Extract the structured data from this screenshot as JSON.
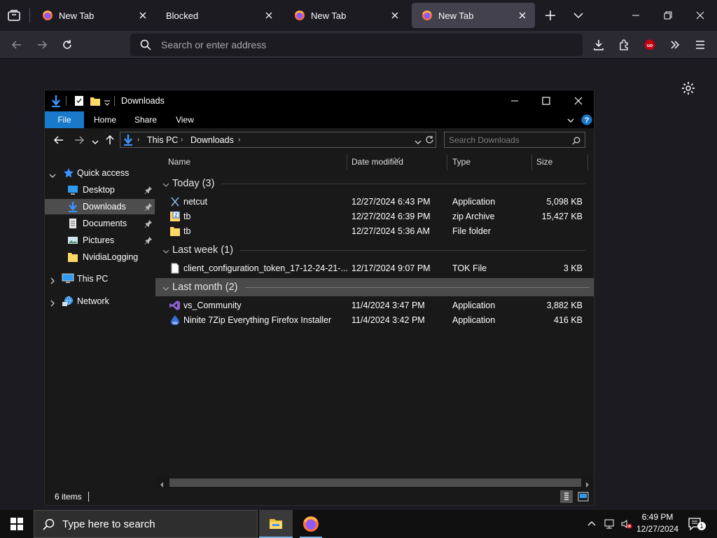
{
  "browser": {
    "tabs": [
      {
        "label": "New Tab",
        "active": false,
        "favicon": "firefox-icon"
      },
      {
        "label": "Blocked",
        "active": false,
        "favicon": ""
      },
      {
        "label": "New Tab",
        "active": false,
        "favicon": "firefox-icon"
      },
      {
        "label": "New Tab",
        "active": true,
        "favicon": "firefox-icon"
      }
    ],
    "urlbar": {
      "placeholder": "Search or enter address"
    },
    "toolbar_icons": [
      "download-icon",
      "extensions-icon",
      "ublock-icon",
      "overflow-icon",
      "menu-icon"
    ],
    "newtab_settings_icon": "gear-icon"
  },
  "explorer": {
    "title": "Downloads",
    "ribbon": {
      "file": "File",
      "home": "Home",
      "share": "Share",
      "view": "View"
    },
    "breadcrumb": {
      "root": "This PC",
      "current": "Downloads"
    },
    "search_placeholder": "Search Downloads",
    "nav": {
      "quick_access": "Quick access",
      "items": [
        {
          "label": "Desktop",
          "icon": "desktop-icon",
          "pinned": true
        },
        {
          "label": "Downloads",
          "icon": "download-arrow-icon",
          "pinned": true,
          "selected": true
        },
        {
          "label": "Documents",
          "icon": "documents-icon",
          "pinned": true
        },
        {
          "label": "Pictures",
          "icon": "pictures-icon",
          "pinned": true
        },
        {
          "label": "NvidiaLogging",
          "icon": "folder-icon",
          "pinned": false
        }
      ],
      "this_pc": "This PC",
      "network": "Network"
    },
    "columns": {
      "name": "Name",
      "date": "Date modified",
      "type": "Type",
      "size": "Size"
    },
    "groups": [
      {
        "label": "Today (3)",
        "files": [
          {
            "name": "netcut",
            "date": "12/27/2024 6:43 PM",
            "type": "Application",
            "size": "5,098 KB",
            "icon": "netcut-icon"
          },
          {
            "name": "tb",
            "date": "12/27/2024 6:39 PM",
            "type": "zip Archive",
            "size": "15,427 KB",
            "icon": "zip-icon"
          },
          {
            "name": "tb",
            "date": "12/27/2024 5:36 AM",
            "type": "File folder",
            "size": "",
            "icon": "folder-icon"
          }
        ]
      },
      {
        "label": "Last week (1)",
        "files": [
          {
            "name": "client_configuration_token_17-12-24-21-...",
            "date": "12/17/2024 9:07 PM",
            "type": "TOK File",
            "size": "3 KB",
            "icon": "file-icon"
          }
        ]
      },
      {
        "label": "Last month (2)",
        "files": [
          {
            "name": "vs_Community",
            "date": "11/4/2024 3:47 PM",
            "type": "Application",
            "size": "3,882 KB",
            "icon": "visual-studio-icon"
          },
          {
            "name": "Ninite 7Zip Everything Firefox Installer",
            "date": "11/4/2024 3:42 PM",
            "type": "Application",
            "size": "416 KB",
            "icon": "ninite-icon"
          }
        ]
      }
    ],
    "status": "6 items"
  },
  "taskbar": {
    "search_placeholder": "Type here to search",
    "time": "6:49 PM",
    "date": "12/27/2024",
    "notification_count": "1"
  }
}
